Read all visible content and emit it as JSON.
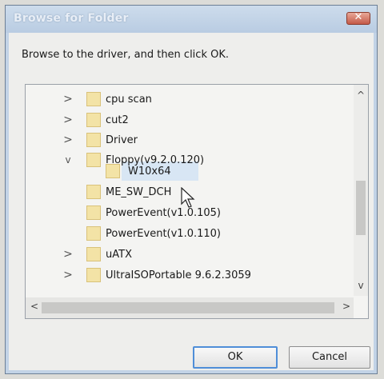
{
  "dialog": {
    "title": "Browse for Folder",
    "close_icon": "close-icon",
    "instruction": "Browse to the driver, and then click OK."
  },
  "tree": {
    "items": [
      {
        "label": "cpu scan",
        "expander": ">"
      },
      {
        "label": "cut2",
        "expander": ">"
      },
      {
        "label": "Driver",
        "expander": ">"
      },
      {
        "label": "Floppy(v9.2.0.120)",
        "expander": "v"
      },
      {
        "label": "W10x64",
        "expander": "",
        "selected": true
      },
      {
        "label": "ME_SW_DCH",
        "expander": ""
      },
      {
        "label": "PowerEvent(v1.0.105)",
        "expander": ""
      },
      {
        "label": "PowerEvent(v1.0.110)",
        "expander": ""
      },
      {
        "label": "uATX",
        "expander": ">"
      },
      {
        "label": "UltraISOPortable 9.6.2.3059",
        "expander": ">"
      }
    ]
  },
  "scrollbars": {
    "up": "^",
    "down": "v",
    "left": "<",
    "right": ">"
  },
  "buttons": {
    "ok_label": "OK",
    "cancel_label": "Cancel"
  },
  "colors": {
    "accent": "#4f8ed8",
    "titlebar": "#c2d3e6",
    "folder": "#f3e3a6"
  }
}
